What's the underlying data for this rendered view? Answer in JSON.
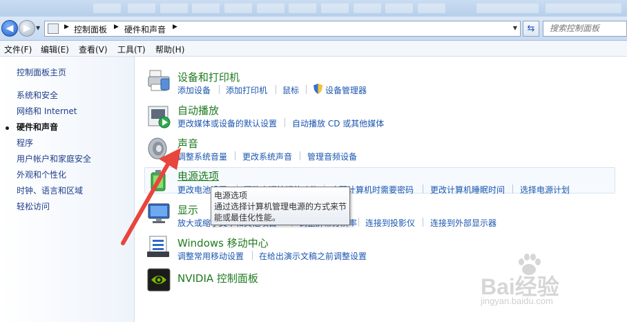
{
  "address": {
    "crumbs": [
      "控制面板",
      "硬件和声音"
    ]
  },
  "search": {
    "placeholder": "搜索控制面板"
  },
  "menu": [
    "文件(F)",
    "编辑(E)",
    "查看(V)",
    "工具(T)",
    "帮助(H)"
  ],
  "sidebar": {
    "home": "控制面板主页",
    "items": [
      "系统和安全",
      "网络和 Internet",
      "硬件和声音",
      "程序",
      "用户帐户和家庭安全",
      "外观和个性化",
      "时钟、语言和区域",
      "轻松访问"
    ],
    "current_index": 2
  },
  "categories": [
    {
      "title": "设备和打印机",
      "tasks": [
        "添加设备",
        "添加打印机",
        "鼠标",
        "设备管理器"
      ]
    },
    {
      "title": "自动播放",
      "tasks": [
        "更改媒体或设备的默认设置",
        "自动播放 CD 或其他媒体"
      ]
    },
    {
      "title": "声音",
      "tasks": [
        "调整系统音量",
        "更改系统声音",
        "管理音频设备"
      ]
    },
    {
      "title": "电源选项",
      "tasks": [
        "更改电池设置",
        "更改电源按钮的功能",
        "唤醒计算机时需要密码",
        "更改计算机睡眠时间",
        "选择电源计划"
      ]
    },
    {
      "title": "显示",
      "tasks": [
        "放大或缩小文本和其他项目",
        "调整屏幕分辨率",
        "连接到投影仪",
        "连接到外部显示器"
      ]
    },
    {
      "title": "Windows 移动中心",
      "tasks": [
        "调整常用移动设置",
        "在给出演示文稿之前调整设置"
      ]
    },
    {
      "title": "NVIDIA 控制面板",
      "tasks": []
    }
  ],
  "tooltip": {
    "title": "电源选项",
    "description": "通过选择计算机管理电源的方式来节能或最佳化性能。"
  },
  "watermark": {
    "brand": "Bai经验",
    "url": "jingyan.baidu.com"
  },
  "colors": {
    "link": "#1a56b0",
    "category": "#1e7a1e",
    "arrow": "#e8453c"
  }
}
